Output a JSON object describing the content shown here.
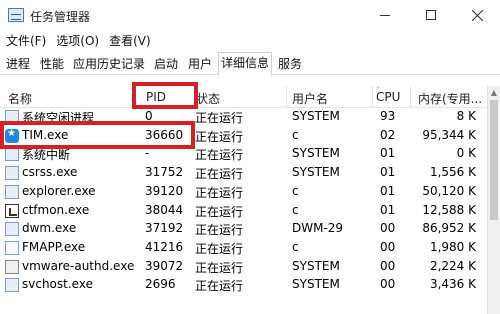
{
  "window": {
    "title": "任务管理器"
  },
  "menu": [
    "文件(F)",
    "选项(O)",
    "查看(V)"
  ],
  "tabs": [
    {
      "label": "进程"
    },
    {
      "label": "性能"
    },
    {
      "label": "应用历史记录"
    },
    {
      "label": "启动"
    },
    {
      "label": "用户"
    },
    {
      "label": "详细信息",
      "active": true
    },
    {
      "label": "服务"
    }
  ],
  "columns": {
    "name": "名称",
    "pid": "PID",
    "status": "状态",
    "user": "用户名",
    "cpu": "CPU",
    "memory": "内存(专用..."
  },
  "processes": [
    {
      "name": "系统空闲进程",
      "pid": "0",
      "status": "正在运行",
      "user": "SYSTEM",
      "cpu": "93",
      "memory": "8 K",
      "icon": "system-icon"
    },
    {
      "name": "TIM.exe",
      "pid": "36660",
      "status": "正在运行",
      "user": "c",
      "cpu": "02",
      "memory": "95,344 K",
      "icon": "tim-app-icon"
    },
    {
      "name": "系统中断",
      "pid": "-",
      "status": "正在运行",
      "user": "SYSTEM",
      "cpu": "01",
      "memory": "0 K",
      "icon": "system-icon"
    },
    {
      "name": "csrss.exe",
      "pid": "31752",
      "status": "正在运行",
      "user": "SYSTEM",
      "cpu": "01",
      "memory": "1,556 K",
      "icon": "window-icon"
    },
    {
      "name": "explorer.exe",
      "pid": "39120",
      "status": "正在运行",
      "user": "c",
      "cpu": "01",
      "memory": "50,120 K",
      "icon": "window-icon"
    },
    {
      "name": "ctfmon.exe",
      "pid": "38044",
      "status": "正在运行",
      "user": "c",
      "cpu": "01",
      "memory": "12,588 K",
      "icon": "ctfmon-icon"
    },
    {
      "name": "dwm.exe",
      "pid": "37192",
      "status": "正在运行",
      "user": "DWM-29",
      "cpu": "00",
      "memory": "86,952 K",
      "icon": "window-icon"
    },
    {
      "name": "FMAPP.exe",
      "pid": "41216",
      "status": "正在运行",
      "user": "c",
      "cpu": "00",
      "memory": "1,980 K",
      "icon": "fmapp-icon"
    },
    {
      "name": "vmware-authd.exe",
      "pid": "39072",
      "status": "正在运行",
      "user": "SYSTEM",
      "cpu": "00",
      "memory": "2,224 K",
      "icon": "vmware-icon"
    },
    {
      "name": "svchost.exe",
      "pid": "2696",
      "status": "正在运行",
      "user": "SYSTEM",
      "cpu": "00",
      "memory": "3,436 K",
      "icon": "window-icon"
    }
  ]
}
